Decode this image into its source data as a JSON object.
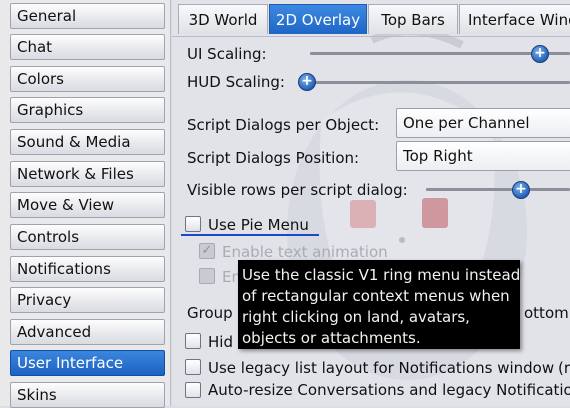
{
  "sidebar": {
    "items": [
      {
        "label": "General"
      },
      {
        "label": "Chat"
      },
      {
        "label": "Colors"
      },
      {
        "label": "Graphics"
      },
      {
        "label": "Sound & Media"
      },
      {
        "label": "Network & Files"
      },
      {
        "label": "Move & View"
      },
      {
        "label": "Controls"
      },
      {
        "label": "Notifications"
      },
      {
        "label": "Privacy"
      },
      {
        "label": "Advanced"
      },
      {
        "label": "User Interface",
        "selected": true
      },
      {
        "label": "Skins"
      }
    ]
  },
  "tabs": [
    {
      "label": "3D World"
    },
    {
      "label": "2D Overlay",
      "active": true
    },
    {
      "label": "Top Bars"
    },
    {
      "label": "Interface Windo"
    }
  ],
  "settings": {
    "ui_scaling": {
      "label": "UI Scaling:",
      "value": 0.87
    },
    "hud_scaling": {
      "label": "HUD Scaling:",
      "value": 0.0
    },
    "dialogs_per_object": {
      "label": "Script Dialogs per Object:",
      "selected": "One per Channel"
    },
    "dialogs_position": {
      "label": "Script Dialogs Position:",
      "selected": "Top Right"
    },
    "visible_rows": {
      "label": "Visible rows per script dialog:",
      "value": 0.6
    },
    "use_pie_menu": {
      "label": "Use Pie Menu",
      "checked": false
    },
    "enable_text_animation": {
      "label": "Enable text animation",
      "checked": true,
      "disabled": true
    },
    "second_disabled": {
      "label": "En",
      "checked": false,
      "disabled": true
    },
    "group_row": {
      "label_left": "Group",
      "label_right": "ottom"
    },
    "hide_row": {
      "label": "Hid",
      "checked": false
    },
    "legacy_list": {
      "label": "Use legacy list layout for Notifications window",
      "checked": false,
      "suffix": "(r"
    },
    "auto_resize": {
      "label": "Auto-resize Conversations and legacy Notification",
      "checked": false
    }
  },
  "tooltip": {
    "lines": [
      "Use the classic V1 ring menu instead",
      "of rectangular context menus when",
      "right clicking on land, avatars,",
      "objects or attachments."
    ]
  },
  "colors": {
    "accent": "#1f66c6",
    "tooltip_bg": "#000000",
    "focus": "#1b49c9"
  }
}
